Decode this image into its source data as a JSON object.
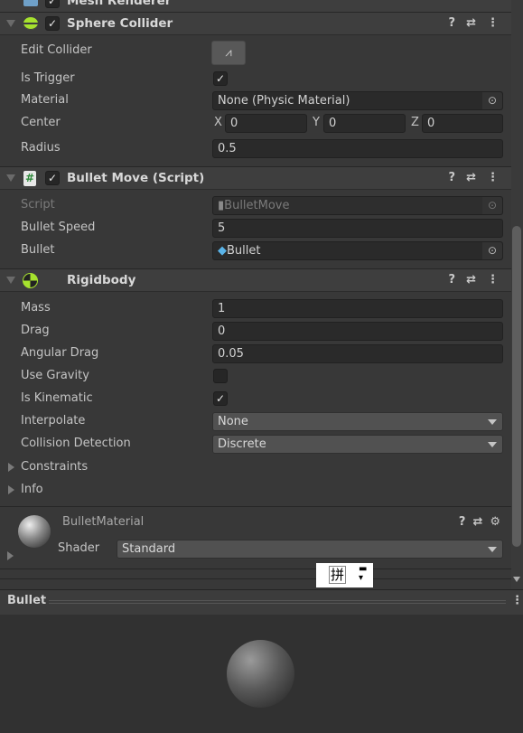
{
  "mesh_renderer": {
    "title": "Mesh Renderer"
  },
  "sphere_collider": {
    "title": "Sphere Collider",
    "enabled": true,
    "edit_collider_label": "Edit Collider",
    "is_trigger_label": "Is Trigger",
    "is_trigger": true,
    "material_label": "Material",
    "material_value": "None (Physic Material)",
    "center_label": "Center",
    "x_label": "X",
    "y_label": "Y",
    "z_label": "Z",
    "center_x": "0",
    "center_y": "0",
    "center_z": "0",
    "radius_label": "Radius",
    "radius_value": "0.5"
  },
  "bullet_move": {
    "title": "Bullet Move (Script)",
    "enabled": true,
    "script_label": "Script",
    "script_value": "BulletMove",
    "speed_label": "Bullet Speed",
    "speed_value": "5",
    "bullet_label": "Bullet",
    "bullet_value": "Bullet"
  },
  "rigidbody": {
    "title": "Rigidbody",
    "mass_label": "Mass",
    "mass_value": "1",
    "drag_label": "Drag",
    "drag_value": "0",
    "angular_drag_label": "Angular Drag",
    "angular_drag_value": "0.05",
    "use_gravity_label": "Use Gravity",
    "use_gravity": false,
    "is_kinematic_label": "Is Kinematic",
    "is_kinematic": true,
    "interpolate_label": "Interpolate",
    "interpolate_value": "None",
    "collision_label": "Collision Detection",
    "collision_value": "Discrete",
    "constraints_label": "Constraints",
    "info_label": "Info"
  },
  "material": {
    "name": "BulletMaterial",
    "shader_label": "Shader",
    "shader_value": "Standard"
  },
  "ime": {
    "glyph": "拼"
  },
  "preview": {
    "title": "Bullet"
  },
  "colors": {
    "collider_green": "#a6e22e",
    "script_icon": "#2f8a3c",
    "prefab_blue": "#5ab4e8"
  }
}
